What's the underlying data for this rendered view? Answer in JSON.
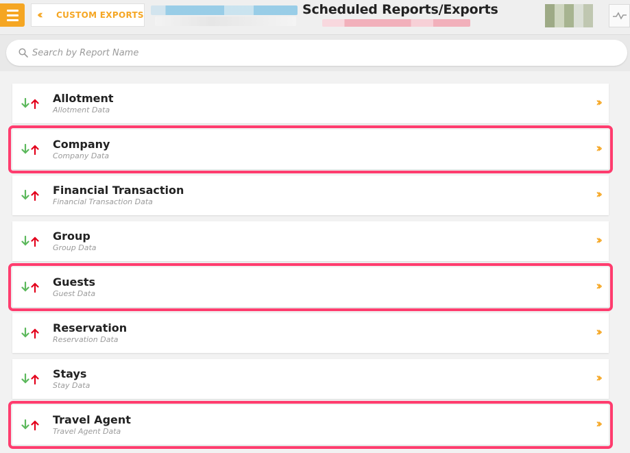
{
  "header": {
    "menu_icon": "hamburger-menu-icon",
    "back_button_label": "CUSTOM EXPORTS",
    "back_icon": "double-chevron-left-icon",
    "title": "Scheduled Reports/Exports",
    "activity_icon": "pulse-icon"
  },
  "colors": {
    "accent": "#f5a623",
    "highlight": "#ff3c6e",
    "arrow_down": "#5cb85c",
    "arrow_up": "#e3001b"
  },
  "search": {
    "placeholder": "Search by Report Name",
    "value": "",
    "icon": "search-icon"
  },
  "reports": [
    {
      "title": "Allotment",
      "subtitle": "Allotment Data",
      "highlighted": false
    },
    {
      "title": "Company",
      "subtitle": "Company Data",
      "highlighted": true
    },
    {
      "title": "Financial Transaction",
      "subtitle": "Financial Transaction Data",
      "highlighted": false
    },
    {
      "title": "Group",
      "subtitle": "Group Data",
      "highlighted": false
    },
    {
      "title": "Guests",
      "subtitle": "Guest Data",
      "highlighted": true
    },
    {
      "title": "Reservation",
      "subtitle": "Reservation Data",
      "highlighted": false
    },
    {
      "title": "Stays",
      "subtitle": "Stay Data",
      "highlighted": false
    },
    {
      "title": "Travel Agent",
      "subtitle": "Travel Agent Data",
      "highlighted": true
    }
  ]
}
